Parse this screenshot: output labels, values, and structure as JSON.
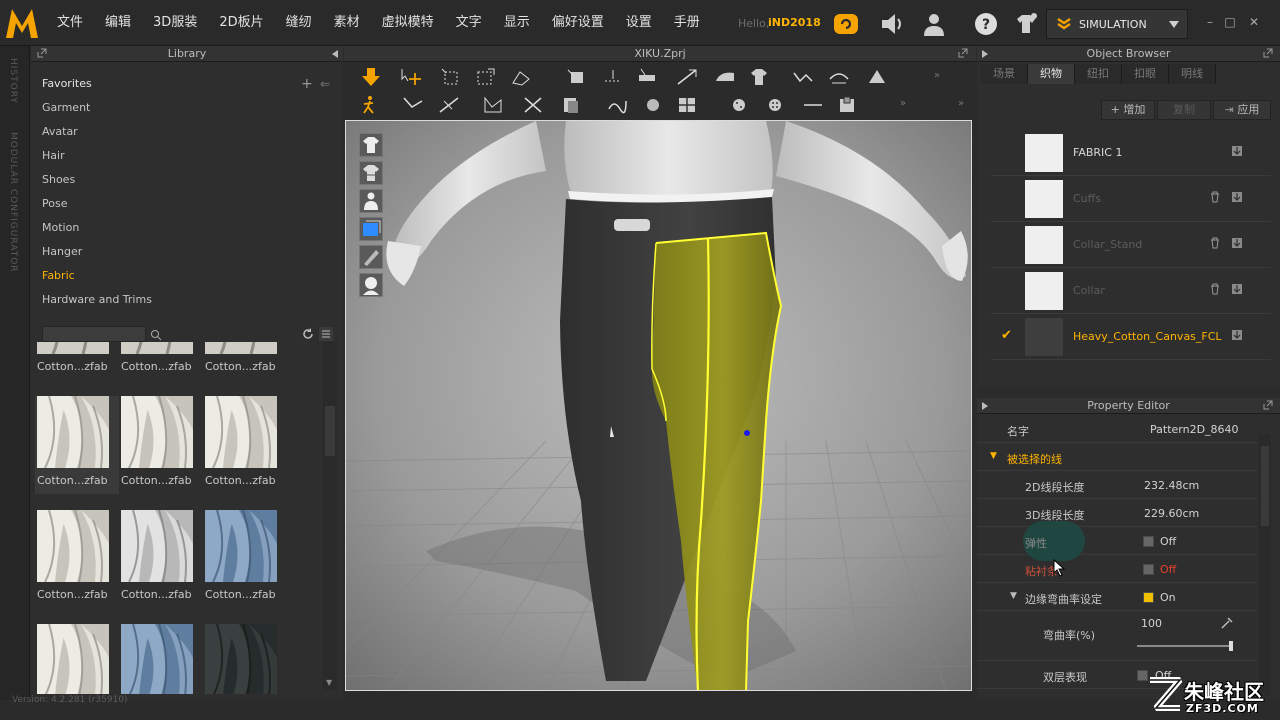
{
  "app": {
    "menu": [
      "文件",
      "编辑",
      "3D服装",
      "2D板片",
      "缝纫",
      "素材",
      "虚拟模特",
      "文字",
      "显示",
      "偏好设置",
      "设置",
      "手册"
    ],
    "hello": "Hello,",
    "username": "iND2018",
    "simulation_label": "SIMULATION",
    "version": "Version: 4.2.281 (r35910)"
  },
  "history_strip": {
    "history_label": "HISTORY",
    "configurator_label": "MODULAR CONFIGURATOR"
  },
  "library": {
    "title": "Library",
    "favorites_title": "Favorites",
    "items": [
      "Garment",
      "Avatar",
      "Hair",
      "Shoes",
      "Pose",
      "Motion",
      "Hanger",
      "Fabric",
      "Hardware and Trims"
    ],
    "active_item": "Fabric",
    "thumbnails": [
      {
        "label": "Cotton...zfab",
        "style": "cream"
      },
      {
        "label": "Cotton...zfab",
        "style": "cream"
      },
      {
        "label": "Cotton...zfab",
        "style": "cream"
      },
      {
        "label": "Cotton...zfab",
        "style": "cream"
      },
      {
        "label": "Cotton...zfab",
        "style": "grey"
      },
      {
        "label": "Cotton...zfab",
        "style": "denim"
      },
      {
        "label": "Cotton...zfab",
        "style": "grey"
      },
      {
        "label": "Cotton...zfab",
        "style": "grey"
      },
      {
        "label": "Cotton...zfab",
        "style": "grey"
      },
      {
        "label": "",
        "style": "cream"
      },
      {
        "label": "",
        "style": "denim"
      },
      {
        "label": "",
        "style": "dark"
      }
    ]
  },
  "view3d": {
    "file_title": "XIKU.Zprj"
  },
  "object_browser": {
    "title": "Object Browser",
    "tabs": [
      "场景",
      "织物",
      "纽扣",
      "扣眼",
      "明线"
    ],
    "active_tab": "织物",
    "add_button": "+ 增加",
    "copy_button": "复制",
    "apply_button": "应用",
    "fabrics": [
      {
        "name": "FABRIC 1",
        "state": "normal",
        "swatch": "#efefef"
      },
      {
        "name": "Cuffs",
        "state": "dim",
        "swatch": "#efefef"
      },
      {
        "name": "Collar_Stand",
        "state": "dim",
        "swatch": "#efefef"
      },
      {
        "name": "Collar",
        "state": "dim",
        "swatch": "#efefef"
      },
      {
        "name": "Heavy_Cotton_Canvas_FCL",
        "state": "active",
        "swatch": "#3e3e3e"
      }
    ]
  },
  "property_editor": {
    "title": "Property Editor",
    "name_label": "名字",
    "name_value": "Pattern2D_8640",
    "section_label": "被选择的线",
    "len2d_label": "2D线段长度",
    "len2d_value": "232.48cm",
    "len3d_label": "3D线段长度",
    "len3d_value": "229.60cm",
    "elastic_label": "弹性",
    "elastic_value": "Off",
    "bond_label": "粘衬条",
    "bond_value": "Off",
    "curve_section_label": "边缘弯曲率设定",
    "curve_section_value": "On",
    "curvature_label": "弯曲率(%)",
    "curvature_value": "100",
    "double_label": "双层表现",
    "double_value": "Off"
  },
  "colors": {
    "accent": "#ffb400",
    "fabric_highlight": "#9c9c1e",
    "off_red": "#e8412c"
  },
  "watermark": {
    "name": "朱峰社区",
    "site": "ZF3D.COM"
  }
}
